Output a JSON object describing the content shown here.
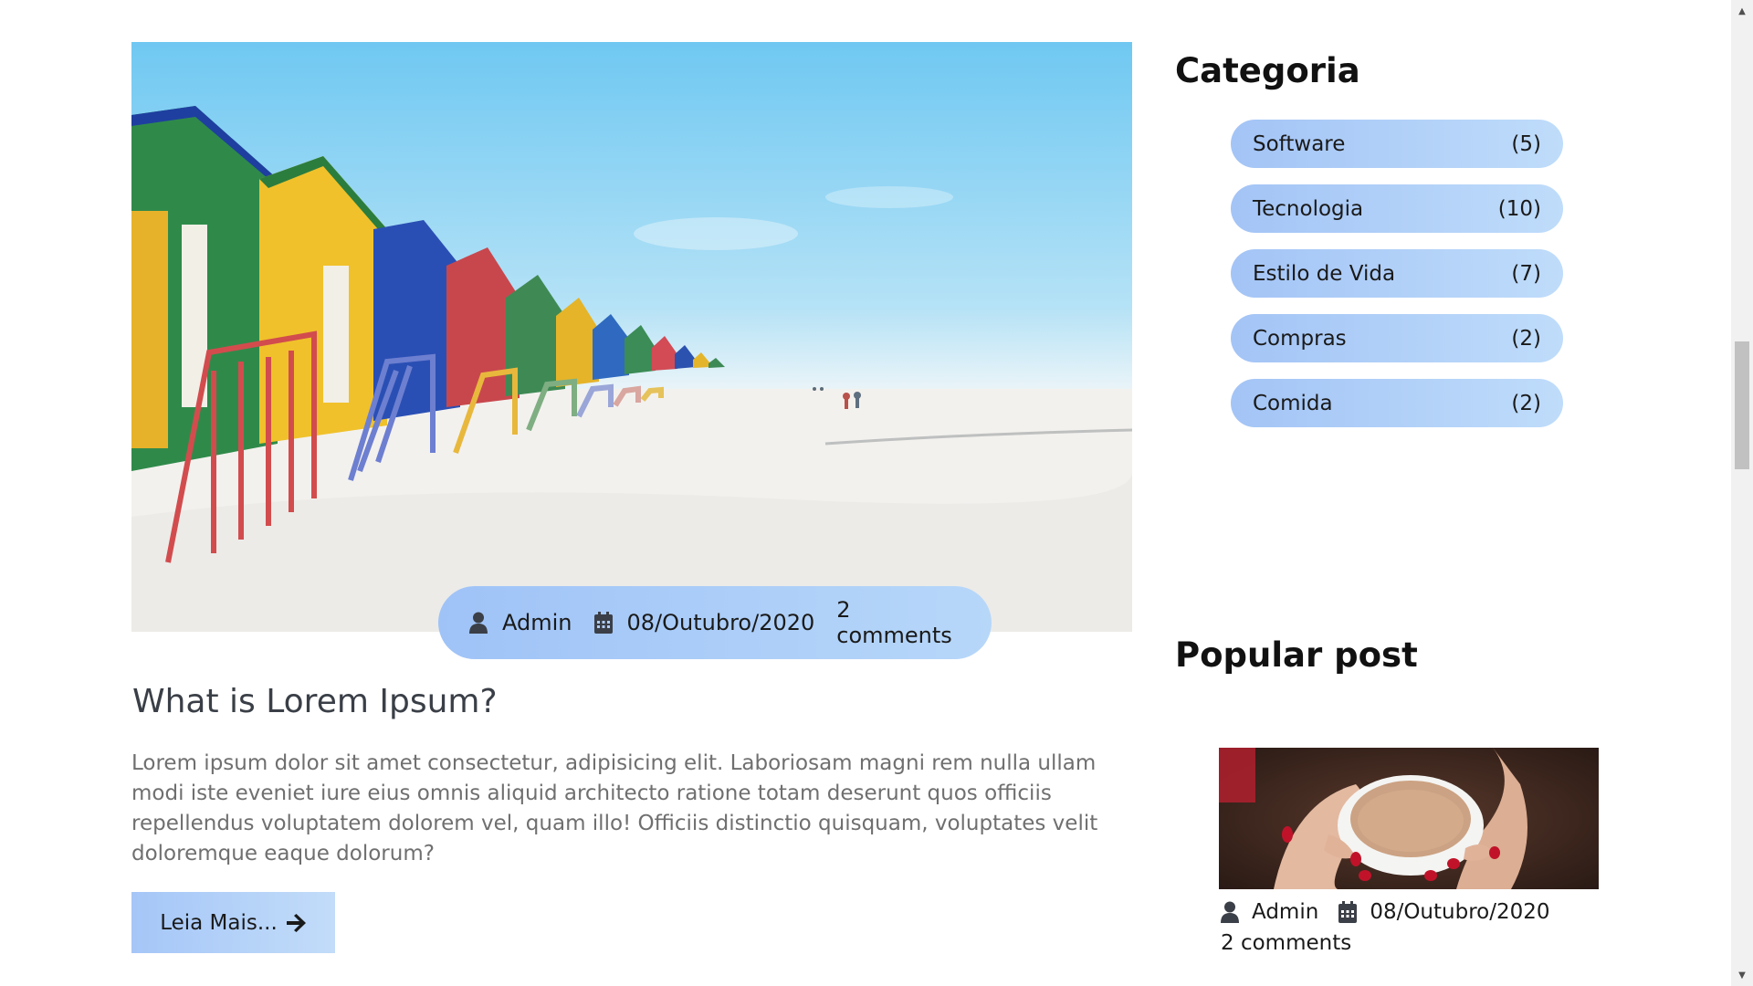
{
  "post": {
    "meta": {
      "author": "Admin",
      "date": "08/Outubro/2020",
      "comments": "2 comments"
    },
    "title": "What is Lorem Ipsum?",
    "excerpt": "Lorem ipsum dolor sit amet consectetur, adipisicing elit. Laboriosam magni rem nulla ullam modi iste eveniet iure eius omnis aliquid architecto ratione totam deserunt quos officiis repellendus voluptatem dolorem vel, quam illo! Officiis distinctio quisquam, voluptates velit doloremque eaque dolorum?",
    "read_more_label": "Leia Mais..."
  },
  "sidebar": {
    "categories_heading": "Categoria",
    "categories": [
      {
        "name": "Software",
        "count": "(5)"
      },
      {
        "name": "Tecnologia",
        "count": "(10)"
      },
      {
        "name": "Estilo de Vida",
        "count": "(7)"
      },
      {
        "name": "Compras",
        "count": "(2)"
      },
      {
        "name": "Comida",
        "count": "(2)"
      }
    ],
    "popular_heading": "Popular post",
    "popular": {
      "author": "Admin",
      "date": "08/Outubro/2020",
      "comments": "2 comments"
    }
  },
  "icons": {
    "author": "user-icon",
    "date": "calendar-icon",
    "read_more": "arrow-right-icon"
  },
  "colors": {
    "accent_start": "#a3c4f6",
    "accent_end": "#bfdcfa",
    "title": "#3a3f47",
    "excerpt": "#6f6f6f"
  }
}
